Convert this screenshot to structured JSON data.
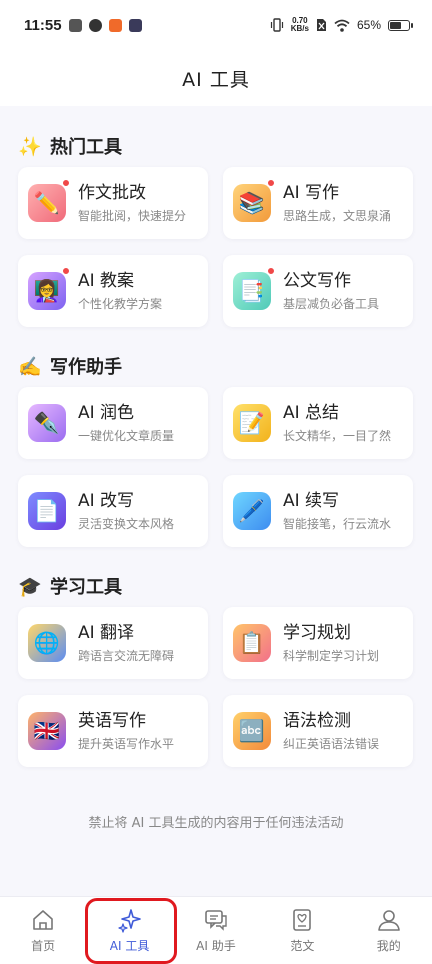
{
  "status_bar": {
    "time": "11:55",
    "net_speed_value": "0.70",
    "net_speed_unit": "KB/s",
    "battery": "65%",
    "battery_level": 0.65
  },
  "header": {
    "title": "AI 工具"
  },
  "sections": [
    {
      "emoji": "✨",
      "title": "热门工具",
      "cards": [
        {
          "title": "作文批改",
          "subtitle": "智能批阅，快速提分",
          "icon": "✏️",
          "icon_name": "pencil-note-icon",
          "gradient": [
            "#ffb0b0",
            "#f06a7a"
          ],
          "dot": true
        },
        {
          "title": "AI 写作",
          "subtitle": "思路生成，文思泉涌",
          "icon": "📚",
          "icon_name": "books-icon",
          "gradient": [
            "#ffd37a",
            "#f29a3b"
          ],
          "dot": true
        },
        {
          "title": "AI 教案",
          "subtitle": "个性化教学方案",
          "icon": "👩‍🏫",
          "icon_name": "teacher-icon",
          "gradient": [
            "#d6a3ff",
            "#7d62f0"
          ],
          "dot": true
        },
        {
          "title": "公文写作",
          "subtitle": "基层减负必备工具",
          "icon": "📑",
          "icon_name": "document-icon",
          "gradient": [
            "#9ef0d6",
            "#4fc9b8"
          ],
          "dot": true
        }
      ]
    },
    {
      "emoji": "✍️",
      "title": "写作助手",
      "cards": [
        {
          "title": "AI 润色",
          "subtitle": "一键优化文章质量",
          "icon": "✒️",
          "icon_name": "fountain-pen-icon",
          "gradient": [
            "#e6b8ff",
            "#9a6cf0"
          ],
          "dot": false
        },
        {
          "title": "AI 总结",
          "subtitle": "长文精华，一目了然",
          "icon": "📝",
          "icon_name": "memo-icon",
          "gradient": [
            "#ffe06a",
            "#f2b21b"
          ],
          "dot": false
        },
        {
          "title": "AI 改写",
          "subtitle": "灵活变换文本风格",
          "icon": "📄",
          "icon_name": "page-icon",
          "gradient": [
            "#7d8cff",
            "#6a3ee0"
          ],
          "dot": false
        },
        {
          "title": "AI 续写",
          "subtitle": "智能接笔，行云流水",
          "icon": "🖊️",
          "icon_name": "pen-icon",
          "gradient": [
            "#6fd6ff",
            "#3d8cf0"
          ],
          "dot": false
        }
      ]
    },
    {
      "emoji": "🎓",
      "title": "学习工具",
      "cards": [
        {
          "title": "AI 翻译",
          "subtitle": "跨语言交流无障碍",
          "icon": "🌐",
          "icon_name": "globe-icon",
          "gradient": [
            "#ffd76a",
            "#5b8cf2"
          ],
          "dot": false
        },
        {
          "title": "学习规划",
          "subtitle": "科学制定学习计划",
          "icon": "📋",
          "icon_name": "clipboard-icon",
          "gradient": [
            "#ffc46a",
            "#f2708a"
          ],
          "dot": false
        },
        {
          "title": "英语写作",
          "subtitle": "提升英语写作水平",
          "icon": "🇬🇧",
          "icon_name": "uk-flag-icon",
          "gradient": [
            "#ffb36a",
            "#8a4ef0"
          ],
          "dot": false
        },
        {
          "title": "语法检测",
          "subtitle": "纠正英语语法错误",
          "icon": "🔤",
          "icon_name": "abc-icon",
          "gradient": [
            "#ffd06a",
            "#f28a3b"
          ],
          "dot": false
        }
      ]
    }
  ],
  "disclaimer": "禁止将 AI 工具生成的内容用于任何违法活动",
  "tabs": [
    {
      "label": "首页",
      "icon_name": "home-icon",
      "active": false
    },
    {
      "label": "AI 工具",
      "icon_name": "sparkle-icon",
      "active": true
    },
    {
      "label": "AI 助手",
      "icon_name": "chat-icon",
      "active": false
    },
    {
      "label": "范文",
      "icon_name": "book-icon",
      "active": false
    },
    {
      "label": "我的",
      "icon_name": "user-icon",
      "active": false
    }
  ],
  "colors": {
    "accent": "#3f5bd8",
    "highlight": "#e0191f",
    "dot": "#f04848",
    "page_bg": "#f7f7fc"
  }
}
